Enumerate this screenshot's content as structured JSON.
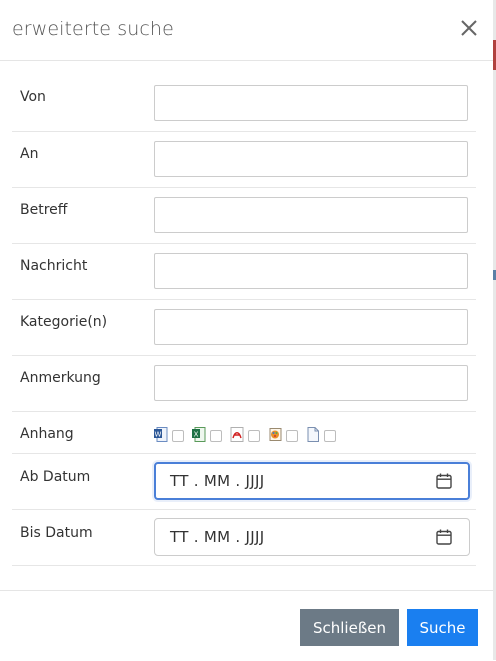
{
  "dialog": {
    "title": "erweiterte suche",
    "close_icon": "close-icon"
  },
  "form": {
    "fields": [
      {
        "label": "Von",
        "value": ""
      },
      {
        "label": "An",
        "value": ""
      },
      {
        "label": "Betreff",
        "value": ""
      },
      {
        "label": "Nachricht",
        "value": ""
      },
      {
        "label": "Kategorie(n)",
        "value": ""
      },
      {
        "label": "Anmerkung",
        "value": ""
      }
    ],
    "attachment": {
      "label": "Anhang",
      "types": [
        {
          "icon": "word-file-icon",
          "checked": false
        },
        {
          "icon": "excel-file-icon",
          "checked": false
        },
        {
          "icon": "pdf-file-icon",
          "checked": false
        },
        {
          "icon": "image-file-icon",
          "checked": false
        },
        {
          "icon": "generic-file-icon",
          "checked": false
        }
      ]
    },
    "date_from": {
      "label": "Ab Datum",
      "placeholder": "TT . MM . JJJJ",
      "focused": true
    },
    "date_to": {
      "label": "Bis Datum",
      "placeholder": "TT . MM . JJJJ",
      "focused": false
    }
  },
  "footer": {
    "close_label": "Schließen",
    "search_label": "Suche"
  },
  "colors": {
    "primary": "#1a7ff0",
    "secondary": "#6c7a86",
    "focus_border": "#4a7fd8"
  }
}
